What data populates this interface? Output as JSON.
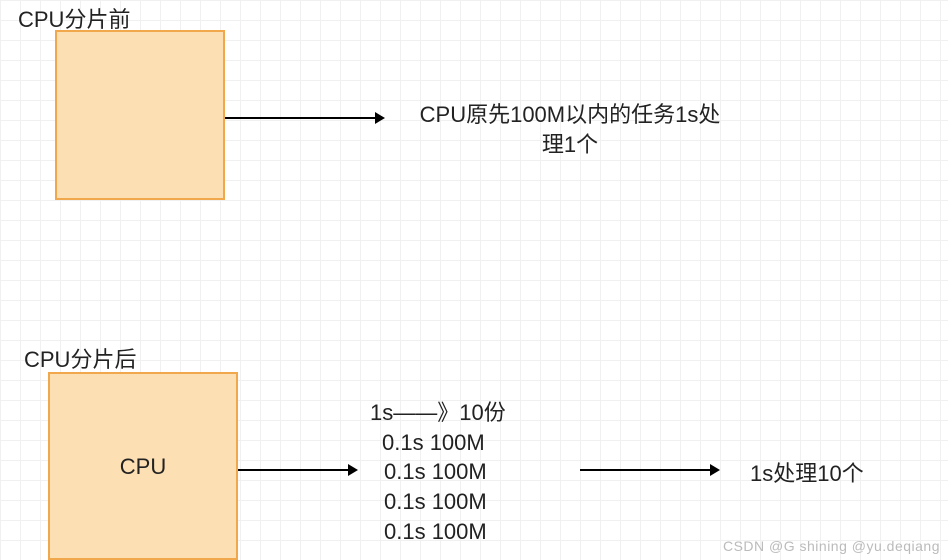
{
  "section1": {
    "title": "CPU分片前",
    "box_label": "",
    "desc_line1": "CPU原先100M以内的任务1s处",
    "desc_line2": "理1个"
  },
  "section2": {
    "title": "CPU分片后",
    "box_label": "CPU",
    "list": {
      "l1": "1s——》10份",
      "l2": "0.1s  100M",
      "l3": "0.1s 100M",
      "l4": "0.1s 100M",
      "l5": "0.1s 100M"
    },
    "result": "1s处理10个"
  },
  "watermark": "CSDN @G shining  @yu.deqiang"
}
